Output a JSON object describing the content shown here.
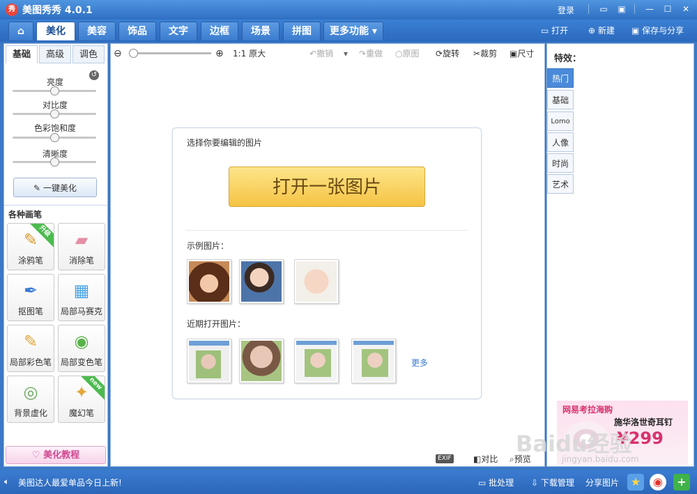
{
  "title_bar": {
    "app_logo": "秀",
    "app_title": "美图秀秀 4.0.1",
    "login": "登录"
  },
  "nav": {
    "tabs": [
      {
        "label": "美化",
        "active": true
      },
      {
        "label": "美容"
      },
      {
        "label": "饰品"
      },
      {
        "label": "文字"
      },
      {
        "label": "边框"
      },
      {
        "label": "场景"
      },
      {
        "label": "拼图"
      },
      {
        "label": "更多功能 ▾"
      }
    ],
    "open": "打开",
    "new": "新建",
    "save_share": "保存与分享"
  },
  "left_panel": {
    "subtabs": [
      "基础",
      "高级",
      "调色"
    ],
    "sliders": [
      {
        "label": "亮度",
        "value": 0.5
      },
      {
        "label": "对比度",
        "value": 0.5
      },
      {
        "label": "色彩饱和度",
        "value": 0.5
      },
      {
        "label": "清晰度",
        "value": 0.5
      }
    ],
    "one_click": "一键美化",
    "brush_section": "各种画笔",
    "brushes": [
      {
        "label": "涂鸦笔",
        "badge": "升级"
      },
      {
        "label": "消除笔"
      },
      {
        "label": "抠图笔"
      },
      {
        "label": "局部马赛克"
      },
      {
        "label": "局部彩色笔"
      },
      {
        "label": "局部变色笔"
      },
      {
        "label": "背景虚化"
      },
      {
        "label": "魔幻笔",
        "badge": "new"
      }
    ],
    "tutorial": "美化教程"
  },
  "toolbar": {
    "actual_size": "1:1 原大",
    "undo": "撤销",
    "redo": "重做",
    "original": "原图",
    "rotate": "旋转",
    "crop": "裁剪",
    "size": "尺寸",
    "zoom_value": 0.0
  },
  "open_card": {
    "prompt": "选择你要编辑的图片",
    "open_button": "打开一张图片",
    "sample_label": "示例图片：",
    "recent_label": "近期打开图片：",
    "more": "更多"
  },
  "canvas_bottom": {
    "exif": "EXIF",
    "compare": "对比",
    "preview": "预览"
  },
  "right_panel": {
    "title": "特效：",
    "tabs": [
      "热门",
      "基础",
      "Lomo",
      "人像",
      "时尚",
      "艺术"
    ],
    "ad_brand": "网易考拉海购",
    "ad_product": "施华洛世奇耳钉",
    "ad_price": "¥299"
  },
  "status_bar": {
    "message": "美图达人最爱单品今日上新!",
    "batch": "批处理",
    "download": "下载管理",
    "share": "分享图片"
  },
  "watermark": {
    "text": "Baidu经验",
    "url": "jingyan.baidu.com"
  }
}
